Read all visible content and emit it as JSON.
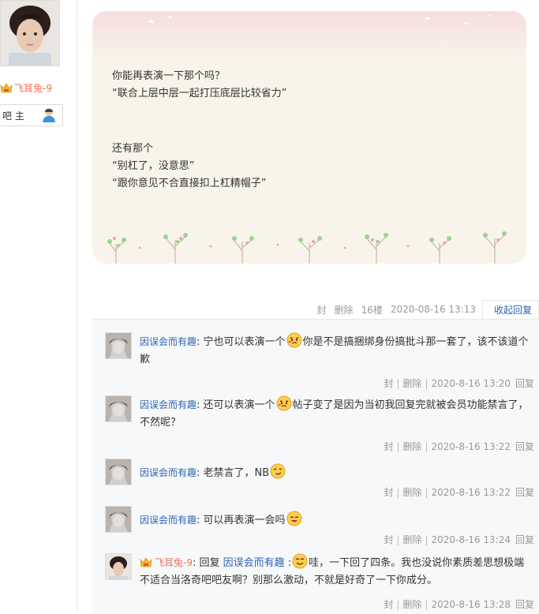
{
  "author": {
    "name": "飞耳兔-9",
    "role": "吧 主"
  },
  "post": {
    "lines": [
      "你能再表演一下那个吗？",
      "“联合上层中层一起打压底层比较省力”",
      "",
      "还有那个",
      "“别杠了，没意思”",
      "“跟你意见不合直接扣上杠精帽子”"
    ]
  },
  "meta": {
    "ban": "封",
    "delete": "删除",
    "floor": "16楼",
    "time": "2020-08-16 13:13",
    "collapse": "收起回复"
  },
  "replies": [
    {
      "user": "因误会而有趣",
      "text1": "宁也可以表演一个",
      "text2": "你是不是搞捆绑身份搞批斗那一套了，该不该道个歉",
      "ban": "封",
      "delete": "删除",
      "time": "2020-8-16 13:20",
      "reply": "回复"
    },
    {
      "user": "因误会而有趣",
      "text1": "还可以表演一个",
      "text2": "帖子变了是因为当初我回复完就被会员功能禁言了，不然呢？",
      "ban": "封",
      "delete": "删除",
      "time": "2020-8-16 13:22",
      "reply": "回复"
    },
    {
      "user": "因误会而有趣",
      "text1": "老禁言了，NB",
      "text2": "",
      "ban": "封",
      "delete": "删除",
      "time": "2020-8-16 13:22",
      "reply": "回复"
    },
    {
      "user": "因误会而有趣",
      "text1": "可以再表演一会吗",
      "text2": "",
      "ban": "封",
      "delete": "删除",
      "time": "2020-8-16 13:24",
      "reply": "回复"
    },
    {
      "user": "飞耳兔-9",
      "reply_word": "回复",
      "mention": "因误会而有趣",
      "text1": "哇，一下回了四条。我也没说你素质差思想极端不适合当洛奇吧吧友啊？别那么激动，不就是好奇了一下你成分。",
      "ban": "封",
      "delete": "删除",
      "time": "2020-8-16 13:28",
      "reply": "回复"
    }
  ],
  "colors": {
    "link": "#2d64b3",
    "vip_name": "#f26d5b",
    "card_bg": "#f8f4ea",
    "reply_bg": "#f7f8fa"
  }
}
